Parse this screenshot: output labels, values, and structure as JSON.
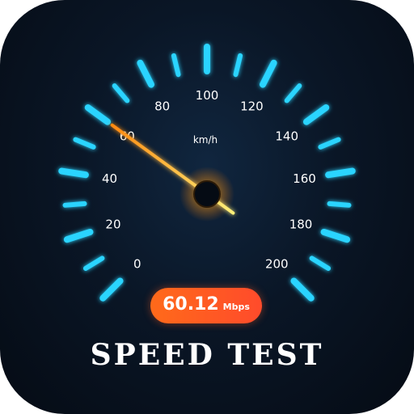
{
  "gauge": {
    "unit": "km/h",
    "min": 0,
    "max": 200,
    "tick_labels": [
      "0",
      "20",
      "40",
      "60",
      "80",
      "100",
      "120",
      "140",
      "160",
      "180",
      "200"
    ],
    "needle_value": 60,
    "tick_color": "#2ad4ff",
    "needle_color": "#ffd21a"
  },
  "result": {
    "value": "60.12",
    "unit": "Mbps",
    "badge_color": "#ff5a22"
  },
  "title": "SPEED TEST"
}
